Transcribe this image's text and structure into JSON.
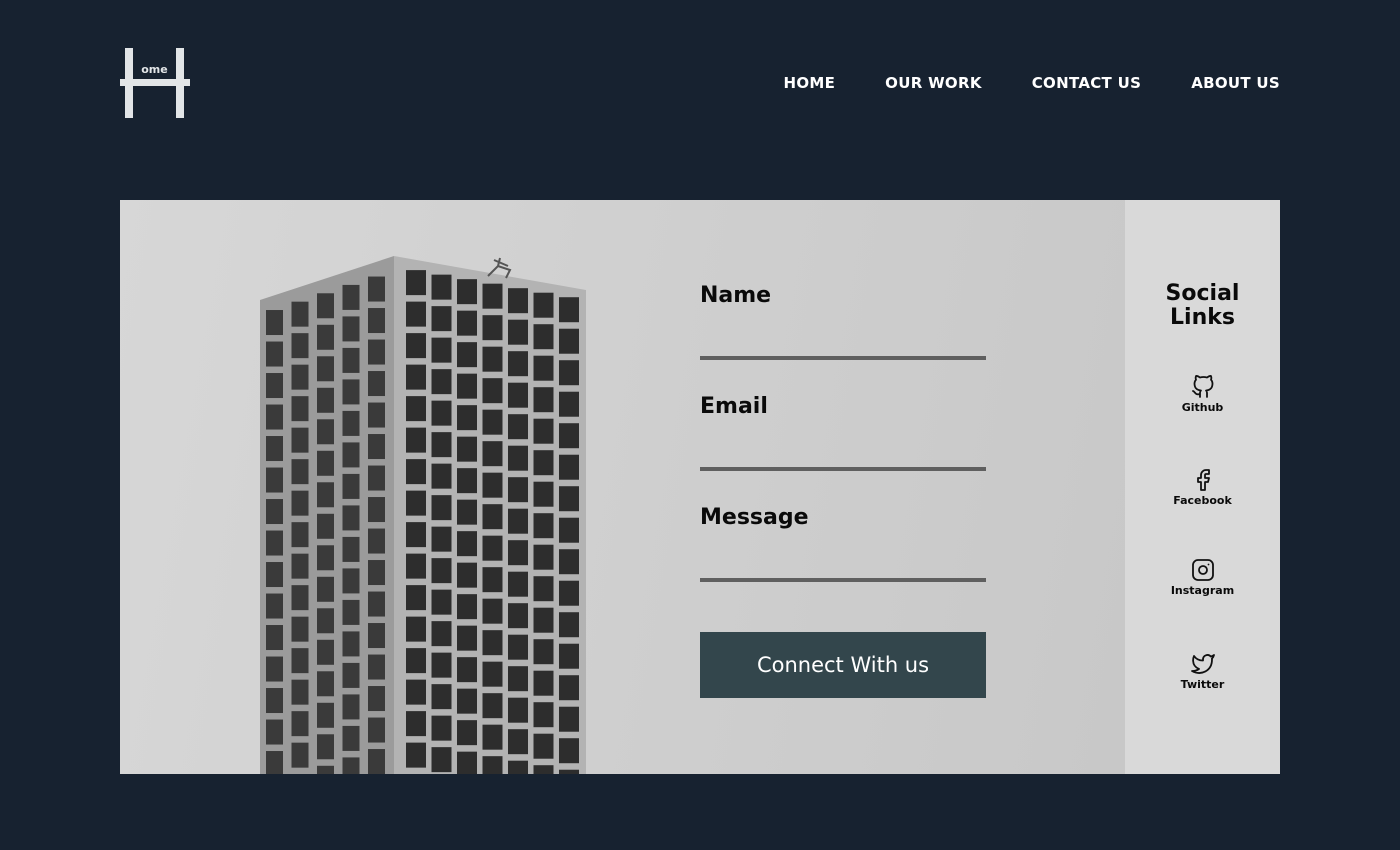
{
  "logo": {
    "text": "ome"
  },
  "nav": {
    "items": [
      "HOME",
      "OUR WORK",
      "CONTACT US",
      "ABOUT US"
    ]
  },
  "form": {
    "name_label": "Name",
    "email_label": "Email",
    "message_label": "Message",
    "submit_label": "Connect With us"
  },
  "social": {
    "title_line1": "Social",
    "title_line2": "Links",
    "items": [
      {
        "label": "Github",
        "icon": "github-icon"
      },
      {
        "label": "Facebook",
        "icon": "facebook-icon"
      },
      {
        "label": "Instagram",
        "icon": "instagram-icon"
      },
      {
        "label": "Twitter",
        "icon": "twitter-icon"
      }
    ]
  },
  "colors": {
    "background": "#172230",
    "button": "#33464c",
    "side_panel": "#d9d9d9"
  }
}
